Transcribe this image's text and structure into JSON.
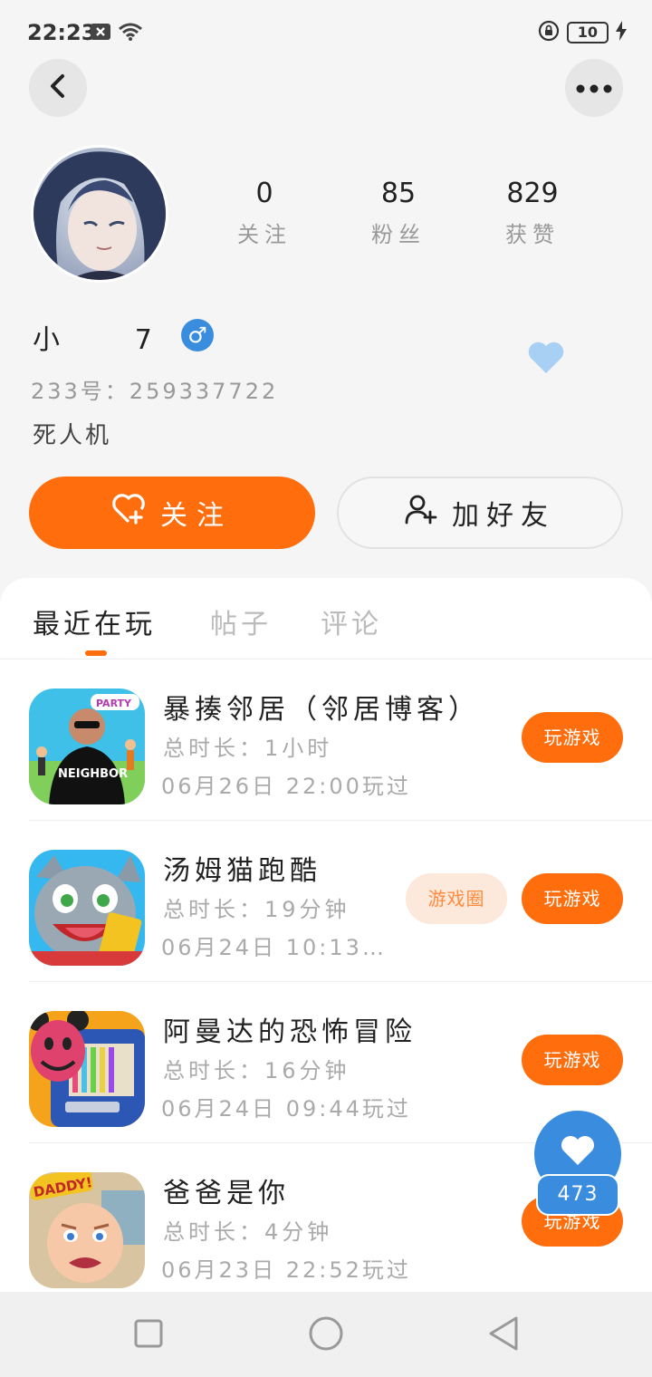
{
  "status_bar": {
    "time": "22:23",
    "battery": "10",
    "icons": [
      "notification-x-icon",
      "wifi-icon",
      "lock-rotation-icon",
      "battery-icon",
      "charging-icon"
    ]
  },
  "header": {
    "back_icon": "chevron-left-icon",
    "more_icon": "more-dots-icon"
  },
  "profile": {
    "username": "小       7",
    "gender_symbol": "♂",
    "user_id": "233号：259337722",
    "bio": "死人机",
    "stats": [
      {
        "value": "0",
        "label": "关注"
      },
      {
        "value": "85",
        "label": "粉丝"
      },
      {
        "value": "829",
        "label": "获赞"
      }
    ]
  },
  "actions": {
    "follow_label": "关注",
    "add_friend_label": "加好友"
  },
  "tabs": [
    {
      "label": "最近在玩",
      "active": true
    },
    {
      "label": "帖子",
      "active": false
    },
    {
      "label": "评论",
      "active": false
    }
  ],
  "games": [
    {
      "title": "暴揍邻居（邻居博客）",
      "duration": "总时长：1小时",
      "last_played": "06月26日 22:00玩过",
      "play_label": "玩游戏"
    },
    {
      "title": "汤姆猫跑酷",
      "duration": "总时长：19分钟",
      "last_played": "06月24日 10:13…",
      "play_label": "玩游戏",
      "circle_label": "游戏圈"
    },
    {
      "title": "阿曼达的恐怖冒险",
      "duration": "总时长：16分钟",
      "last_played": "06月24日 09:44玩过",
      "play_label": "玩游戏"
    },
    {
      "title": "爸爸是你",
      "duration": "总时长：4分钟",
      "last_played": "06月23日 22:52玩过",
      "play_label": "玩游戏"
    }
  ],
  "floating_like": {
    "count": "473"
  },
  "colors": {
    "accent_orange": "#ff6d0c",
    "accent_blue": "#3a8dde",
    "heart_light_blue": "#a8d0f5"
  }
}
